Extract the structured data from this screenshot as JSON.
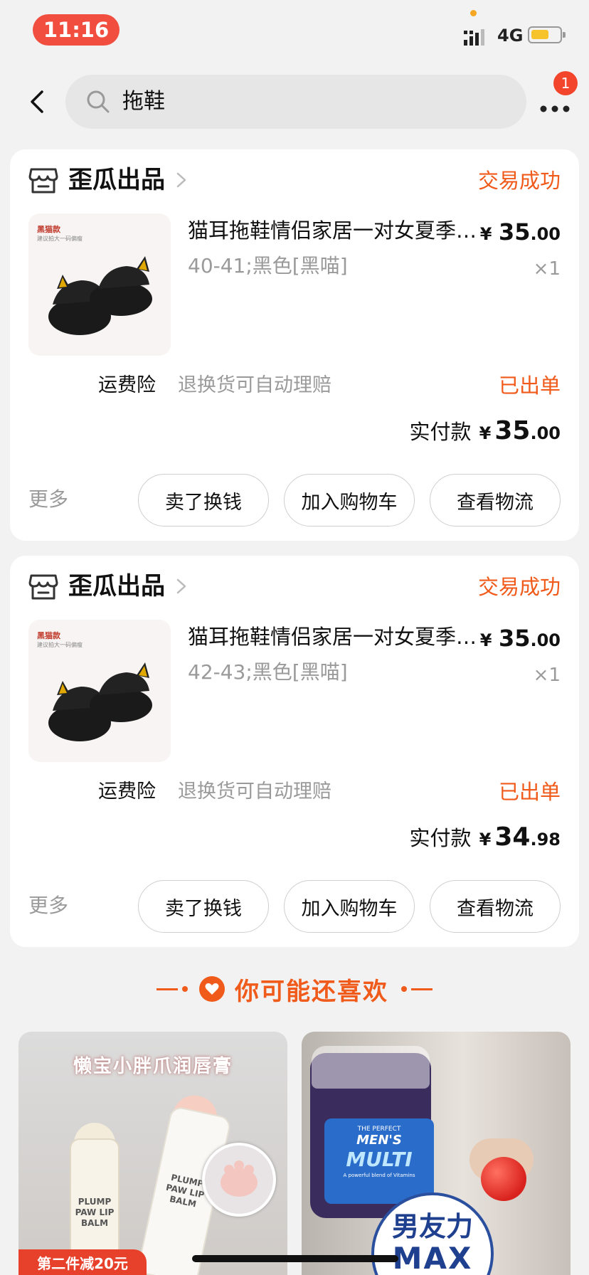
{
  "status_bar": {
    "time": "11:16",
    "network": "4G",
    "colors": {
      "time_pill": "#f24e3f",
      "battery": "#f6c42a"
    }
  },
  "header": {
    "search_query": "拖鞋",
    "more_badge": "1"
  },
  "orders": [
    {
      "shop_name": "歪瓜出品",
      "status": "交易成功",
      "thumb_label": "黑猫款",
      "thumb_sub": "建议拍大一码偏瘦",
      "product_title": "猫耳拖鞋情侣家居一对女夏季家用防滑软底男士冬季可...",
      "price_symbol": "¥",
      "price_int": "35",
      "price_dec": ".00",
      "spec": "40-41;黑色[黑喵]",
      "qty": "×1",
      "insurance_label": "运费险",
      "insurance_desc": "退换货可自动理赔",
      "ship_status": "已出单",
      "paid_label": "实付款",
      "paid_symbol": "¥",
      "paid_int": "35",
      "paid_dec": ".00",
      "more_label": "更多",
      "buttons": {
        "sell": "卖了换钱",
        "cart": "加入购物车",
        "track": "查看物流"
      }
    },
    {
      "shop_name": "歪瓜出品",
      "status": "交易成功",
      "thumb_label": "黑猫款",
      "thumb_sub": "建议拍大一码偏瘦",
      "product_title": "猫耳拖鞋情侣家居一对女夏季家用防滑软底男士冬季可...",
      "price_symbol": "¥",
      "price_int": "35",
      "price_dec": ".00",
      "spec": "42-43;黑色[黑喵]",
      "qty": "×1",
      "insurance_label": "运费险",
      "insurance_desc": "退换货可自动理赔",
      "ship_status": "已出单",
      "paid_label": "实付款",
      "paid_symbol": "¥",
      "paid_int": "34",
      "paid_dec": ".98",
      "more_label": "更多",
      "buttons": {
        "sell": "卖了换钱",
        "cart": "加入购物车",
        "track": "查看物流"
      }
    }
  ],
  "recommend": {
    "title": "你可能还喜欢",
    "accent_color": "#f05a1a",
    "items": [
      {
        "headline": "懒宝小胖爪润唇膏",
        "product_label_1": "PLUMP PAW LIP BALM",
        "product_label_2": "PLUMP PAW LIP BALM",
        "promo": "第二件减20元"
      },
      {
        "jar_line_1": "THE PERFECT",
        "jar_line_2": "MEN'S",
        "jar_line_3": "MULTI",
        "jar_line_4": "A powerful blend of Vitamins",
        "badge_line_1": "男友力",
        "badge_line_2": "MAX"
      }
    ]
  }
}
